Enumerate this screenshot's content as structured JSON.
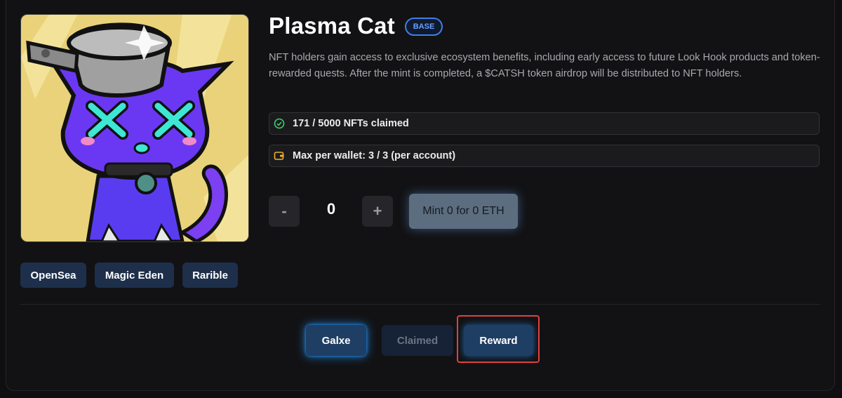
{
  "nft": {
    "title": "Plasma Cat",
    "network_badge": "BASE",
    "description": "NFT holders gain access to exclusive ecosystem benefits, including early access to future Look Hook products and token-rewarded quests. After the mint is completed, a $CATSH token airdrop will be distributed to NFT holders.",
    "claimed_text": "171 / 5000 NFTs claimed",
    "max_per_wallet_text": "Max per wallet: 3 / 3 (per account)"
  },
  "mint": {
    "decrement_label": "-",
    "quantity": "0",
    "increment_label": "+",
    "button_label": "Mint 0 for 0 ETH"
  },
  "marketplaces": [
    "OpenSea",
    "Magic Eden",
    "Rarible"
  ],
  "actions": {
    "galxe_label": "Galxe",
    "claimed_label": "Claimed",
    "reward_label": "Reward"
  },
  "icons": {
    "claimed": "check-circle-icon",
    "wallet": "wallet-icon"
  },
  "colors": {
    "accent_blue": "#3f7ee6",
    "success_green": "#3ecf6a",
    "wallet_yellow": "#f0b429",
    "highlight_red": "#e0413d"
  }
}
